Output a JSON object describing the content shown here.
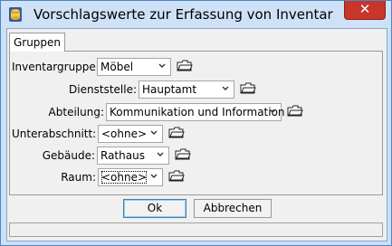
{
  "window": {
    "title": "Vorschlagswerte zur Erfassung von Inventar",
    "close_glyph": "✕"
  },
  "tabs": [
    {
      "label": "Gruppen"
    }
  ],
  "fields": {
    "inventargruppe": {
      "label": "Inventargruppe:",
      "value": "Möbel"
    },
    "dienststelle": {
      "label": "Dienststelle:",
      "value": "Hauptamt"
    },
    "abteilung": {
      "label": "Abteilung:",
      "value": "Kommunikation und Information"
    },
    "unterabschnitt": {
      "label": "Unterabschnitt:",
      "value": "<ohne>"
    },
    "gebaeude": {
      "label": "Gebäude:",
      "value": "Rathaus"
    },
    "raum": {
      "label": "Raum:",
      "value": "<ohne>"
    }
  },
  "buttons": {
    "ok": "Ok",
    "cancel": "Abbrechen"
  },
  "icons": {
    "app": "database-icon",
    "folder": "open-folder-icon",
    "dropdown": "chevron-down-icon"
  },
  "colors": {
    "titlebar": "#cfe1f6",
    "close": "#c7352b",
    "dialog": "#f0f0f0"
  }
}
